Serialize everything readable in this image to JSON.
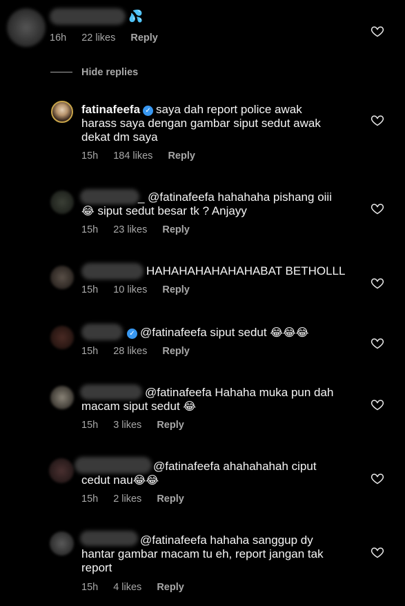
{
  "top_comment": {
    "time": "16h",
    "likes": "22 likes",
    "reply": "Reply",
    "emoji": "💦"
  },
  "hide_replies": "Hide replies",
  "replies": [
    {
      "username": "fatinafeefa",
      "line1": "saya dah report police awak",
      "line2": "harass saya dengan gambar siput sedut awak",
      "line3": "dekat dm saya",
      "time": "15h",
      "likes": "184 likes",
      "reply": "Reply"
    },
    {
      "line1": "_ @fatinafeefa hahahaha pishang oiii",
      "line2": "siput sedut besar tk ? Anjayy",
      "emoji1": "😂",
      "time": "15h",
      "likes": "23 likes",
      "reply": "Reply"
    },
    {
      "line1": "HAHAHAHAHAHAHABAT BETHOLLL",
      "time": "15h",
      "likes": "10 likes",
      "reply": "Reply"
    },
    {
      "line1": "@fatinafeefa siput sedut",
      "emoji1": "😂😂😂",
      "time": "15h",
      "likes": "28 likes",
      "reply": "Reply"
    },
    {
      "line1": "@fatinafeefa Hahaha muka pun dah",
      "line2": "macam siput sedut",
      "emoji1": "😂",
      "time": "15h",
      "likes": "3 likes",
      "reply": "Reply"
    },
    {
      "line1": "@fatinafeefa ahahahahah ciput",
      "line2": "cedut nau",
      "emoji1": "😂😂",
      "time": "15h",
      "likes": "2 likes",
      "reply": "Reply"
    },
    {
      "line1": "@fatinafeefa hahaha sanggup dy",
      "line2": "hantar gambar macam tu eh, report jangan tak",
      "line3": "report",
      "time": "15h",
      "likes": "4 likes",
      "reply": "Reply"
    }
  ]
}
